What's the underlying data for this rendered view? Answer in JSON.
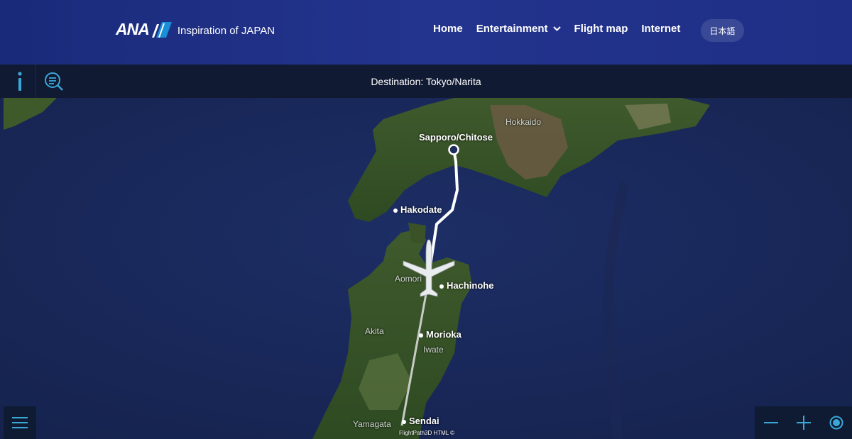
{
  "header": {
    "brand": "ANA",
    "tagline": "Inspiration of JAPAN",
    "nav": {
      "home": "Home",
      "entertainment": "Entertainment",
      "flight_map": "Flight map",
      "internet": "Internet"
    },
    "language_button": "日本語"
  },
  "infobar": {
    "destination": "Destination: Tokyo/Narita"
  },
  "map": {
    "cities": {
      "sapporo": "Sapporo/Chitose",
      "hakodate": "Hakodate",
      "hachinohe": "Hachinohe",
      "morioka": "Morioka",
      "sendai": "Sendai"
    },
    "regions": {
      "hokkaido": "Hokkaido",
      "aomori": "Aomori",
      "akita": "Akita",
      "iwate": "Iwate",
      "yamagata": "Yamagata"
    },
    "credit": "FlightPath3D HTML ©"
  },
  "controls": {
    "menu_icon": "hamburger-icon",
    "zoom_out_icon": "minus-icon",
    "zoom_in_icon": "plus-icon",
    "recenter_icon": "target-icon"
  },
  "colors": {
    "brand_blue": "#1a2a7a",
    "accent_cyan": "#3aa7d6",
    "route_white": "#ffffff"
  }
}
